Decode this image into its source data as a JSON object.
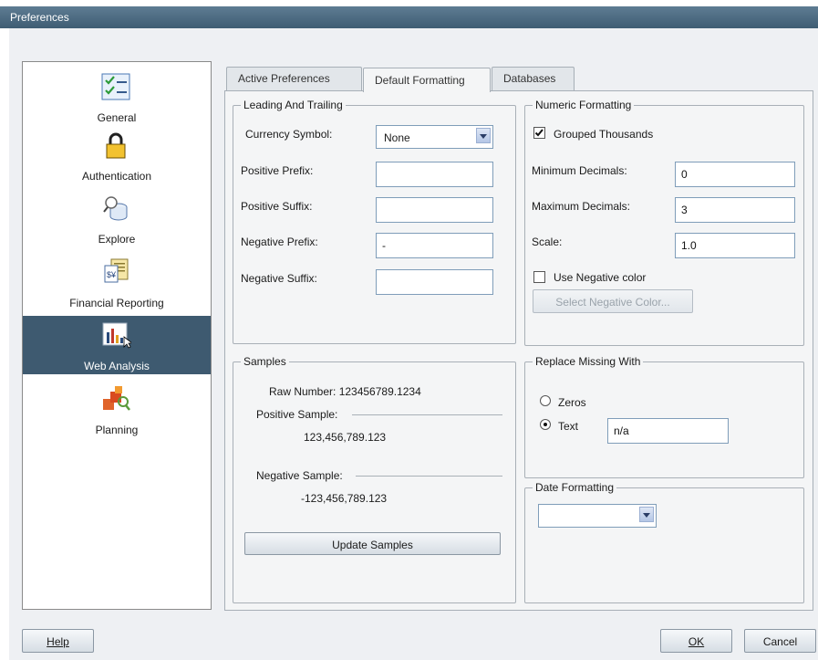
{
  "window": {
    "title": "Preferences"
  },
  "categories": [
    {
      "label": "General",
      "icon": "checklist-icon",
      "selected": false
    },
    {
      "label": "Authentication",
      "icon": "padlock-icon",
      "selected": false
    },
    {
      "label": "Explore",
      "icon": "magnifier-database-icon",
      "selected": false
    },
    {
      "label": "Financial Reporting",
      "icon": "report-sheet-icon",
      "selected": false
    },
    {
      "label": "Web Analysis",
      "icon": "bar-chart-icon",
      "selected": true
    },
    {
      "label": "Planning",
      "icon": "planning-blocks-icon",
      "selected": false
    }
  ],
  "tabs": [
    {
      "label": "Active Preferences"
    },
    {
      "label": "Default Formatting"
    },
    {
      "label": "Databases"
    }
  ],
  "leading_trailing": {
    "title": "Leading And Trailing",
    "currency_label": "Currency Symbol:",
    "currency_value": "None",
    "positive_prefix_label": "Positive Prefix:",
    "positive_prefix_value": "",
    "positive_suffix_label": "Positive Suffix:",
    "positive_suffix_value": "",
    "negative_prefix_label": "Negative Prefix:",
    "negative_prefix_value": "-",
    "negative_suffix_label": "Negative Suffix:",
    "negative_suffix_value": ""
  },
  "numeric": {
    "title": "Numeric Formatting",
    "grouped_label": "Grouped Thousands",
    "grouped_checked": true,
    "min_label": "Minimum Decimals:",
    "min_value": "0",
    "max_label": "Maximum Decimals:",
    "max_value": "3",
    "scale_label": "Scale:",
    "scale_value": "1.0",
    "neg_color_label": "Use Negative color",
    "neg_color_checked": false,
    "select_neg_color_label": "Select Negative Color..."
  },
  "samples": {
    "title": "Samples",
    "raw_number": "Raw Number: 123456789.1234",
    "positive_label": "Positive Sample:",
    "positive_value": "123,456,789.123",
    "negative_label": "Negative Sample:",
    "negative_value": "-123,456,789.123",
    "update_label": "Update Samples"
  },
  "replace_missing": {
    "title": "Replace Missing With",
    "zeros_label": "Zeros",
    "text_label": "Text",
    "text_value": "n/a",
    "selected": "Text"
  },
  "date_formatting": {
    "title": "Date Formatting",
    "value": ""
  },
  "footer": {
    "help_label": "Help",
    "ok_label": "OK",
    "cancel_label": "Cancel"
  },
  "colors": {
    "titlebar": "#4a6880",
    "selected_category": "#3e5a70",
    "border": "#7f9db9"
  }
}
